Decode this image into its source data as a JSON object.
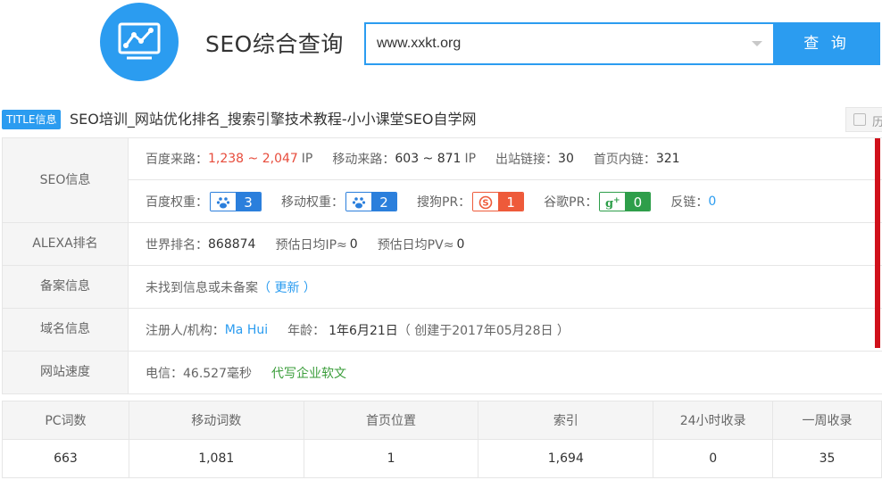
{
  "header": {
    "app_title": "SEO综合查询",
    "search": {
      "value": "www.xxkt.org"
    },
    "query_button": "查 询"
  },
  "title_row": {
    "badge": "TITLE信息",
    "text": "SEO培训_网站优化排名_搜索引擎技术教程-小小课堂SEO自学网",
    "history_label": "历"
  },
  "seo": {
    "label": "SEO信息",
    "baidu_traffic_label": "百度来路：",
    "baidu_traffic_value": "1,238 ~ 2,047",
    "ip_unit": "IP",
    "mobile_traffic_label": "移动来路：",
    "mobile_traffic_value": "603 ~ 871",
    "outbound_label": "出站链接：",
    "outbound_value": "30",
    "inbound_label": "首页内链：",
    "inbound_value": "321",
    "baidu_weight_label": "百度权重：",
    "baidu_weight_value": "3",
    "mobile_weight_label": "移动权重：",
    "mobile_weight_value": "2",
    "sogou_pr_label": "搜狗PR：",
    "sogou_pr_value": "1",
    "google_pr_label": "谷歌PR：",
    "google_pr_value": "0",
    "backlinks_label": "反链：",
    "backlinks_value": "0"
  },
  "alexa": {
    "label": "ALEXA排名",
    "world_rank_label": "世界排名：",
    "world_rank_value": "868874",
    "daily_ip_label": "预估日均IP≈",
    "daily_ip_value": "0",
    "daily_pv_label": "预估日均PV≈",
    "daily_pv_value": "0"
  },
  "icp": {
    "label": "备案信息",
    "text": "未找到信息或未备案",
    "update_link": "（ 更新 ）"
  },
  "domain": {
    "label": "域名信息",
    "registrant_label": "注册人/机构：",
    "registrant_value": "Ma Hui",
    "age_label": "年龄：",
    "age_value": "1年6月21日",
    "created": "（ 创建于2017年05月28日 ）"
  },
  "speed": {
    "label": "网站速度",
    "telecom": "电信：46.527毫秒",
    "ad_link": "代写企业软文"
  },
  "stats": {
    "headers": [
      "PC词数",
      "移动词数",
      "首页位置",
      "索引",
      "24小时收录",
      "一周收录"
    ],
    "values": [
      "663",
      "1,081",
      "1",
      "1,694",
      "0",
      "35"
    ]
  },
  "colors": {
    "accent": "#2b9cf0",
    "red": "#e74c3c",
    "link_blue": "#2b9cf0",
    "green": "#3a9d3a",
    "side_bar": "#d0111b"
  },
  "icons": [
    "monitor-chart-icon",
    "dropdown-caret-icon",
    "baidu-paw-icon",
    "sogou-s-icon",
    "google-plus-icon",
    "history-icon"
  ]
}
